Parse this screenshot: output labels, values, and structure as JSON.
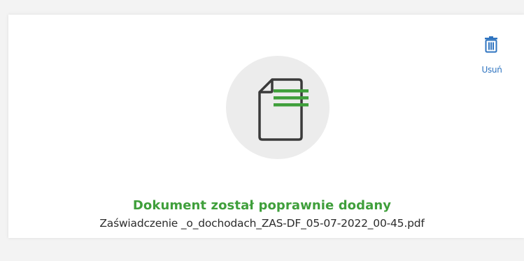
{
  "upload": {
    "delete_label": "Usuń",
    "status_message": "Dokument został poprawnie dodany",
    "file_name": "Zaświadczenie _o_dochodach_ZAS-DF_05-07-2022_00-45.pdf"
  },
  "icons": {
    "delete": "trash-icon",
    "document": "document-icon"
  },
  "colors": {
    "success": "#3f9f3b",
    "link": "#2f74c0",
    "icon_circle": "#ececec"
  }
}
